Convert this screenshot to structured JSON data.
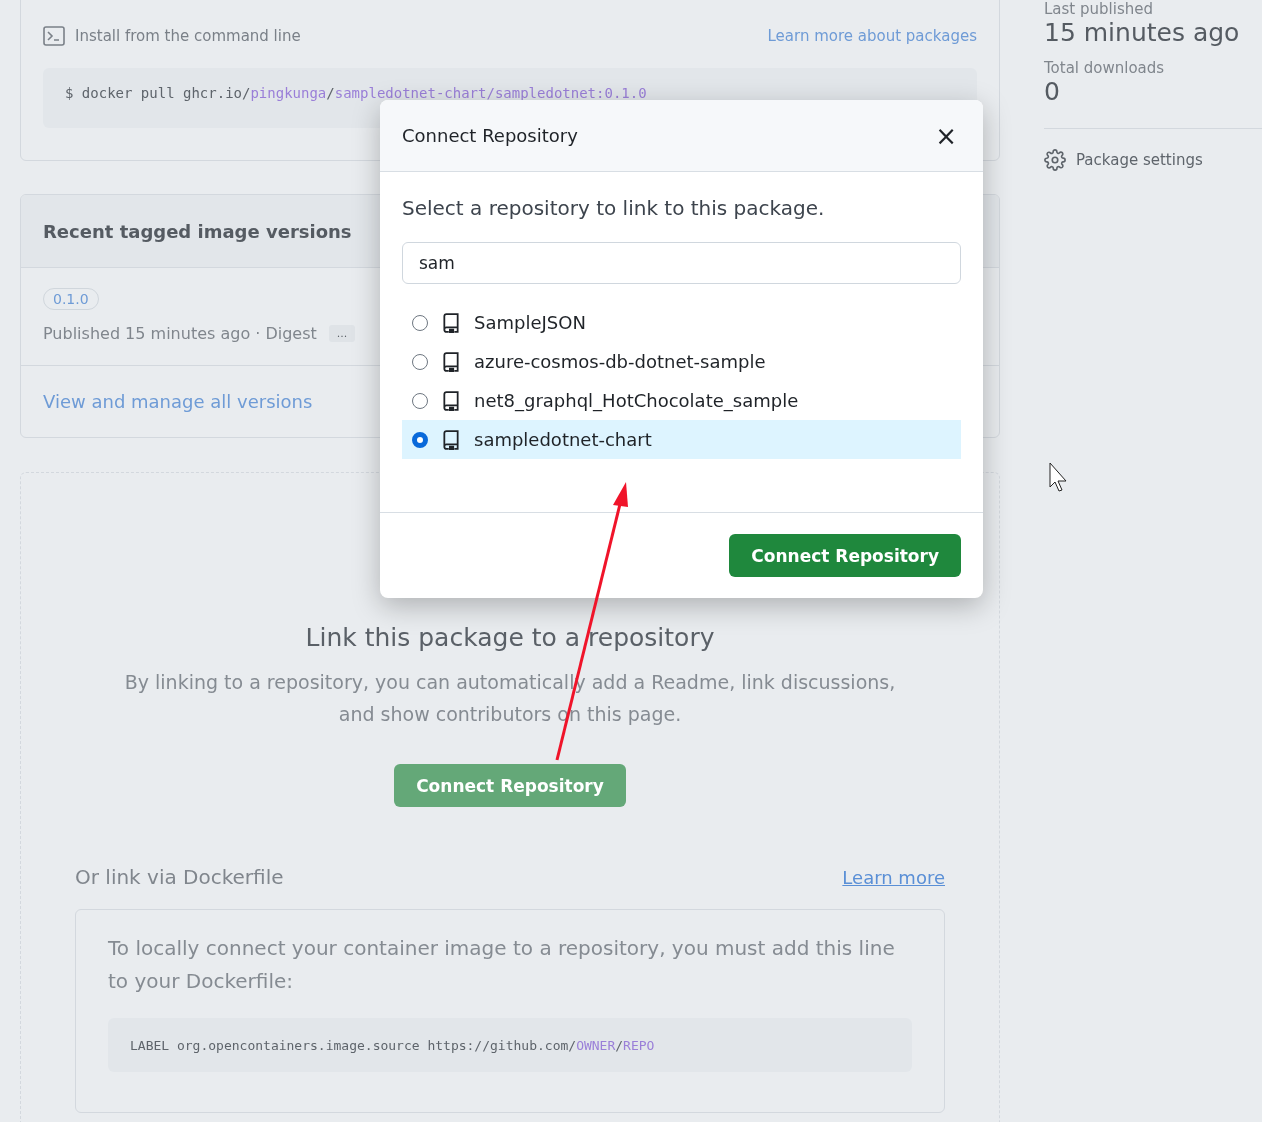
{
  "install": {
    "title": "Install from the command line",
    "link": "Learn more about packages",
    "command": [
      {
        "text": "$ docker pull ghcr.io/",
        "kind": "plain"
      },
      {
        "text": "pingkunga",
        "kind": "var"
      },
      {
        "text": "/",
        "kind": "plain"
      },
      {
        "text": "sampledotnet-chart/sampledotnet:0.1.0",
        "kind": "var"
      }
    ]
  },
  "versions": {
    "title": "Recent tagged image versions",
    "tag": "0.1.0",
    "meta": "Published 15 minutes ago · Digest",
    "more": "...",
    "view_all": "View and manage all versions"
  },
  "link_section": {
    "title": "Link this package to a repository",
    "description": "By linking to a repository, you can automatically add a Readme, link discussions, and show contributors on this page.",
    "button": "Connect Repository",
    "dockerfile_title": "Or link via Dockerfile",
    "learn_more": "Learn more",
    "instructions": "To locally connect your container image to a repository, you must add this line to your Dockerfile:",
    "code": [
      {
        "text": "LABEL org.opencontainers.image.source https://github.com/",
        "kind": "plain"
      },
      {
        "text": "OWNER",
        "kind": "var"
      },
      {
        "text": "/",
        "kind": "plain"
      },
      {
        "text": "REPO",
        "kind": "var"
      }
    ]
  },
  "sidebar": {
    "stats": [
      {
        "label": "Last published",
        "value": "15 minutes ago"
      },
      {
        "label": "Total downloads",
        "value": "0"
      }
    ],
    "settings": "Package settings"
  },
  "modal": {
    "title": "Connect Repository",
    "close": "×",
    "prompt": "Select a repository to link to this package.",
    "search": {
      "value": "sam"
    },
    "repos": [
      {
        "name": "SampleJSON",
        "selected": false
      },
      {
        "name": "azure-cosmos-db-dotnet-sample",
        "selected": false
      },
      {
        "name": "net8_graphql_HotChocolate_sample",
        "selected": false
      },
      {
        "name": "sampledotnet-chart",
        "selected": true
      }
    ],
    "button": "Connect Repository"
  }
}
